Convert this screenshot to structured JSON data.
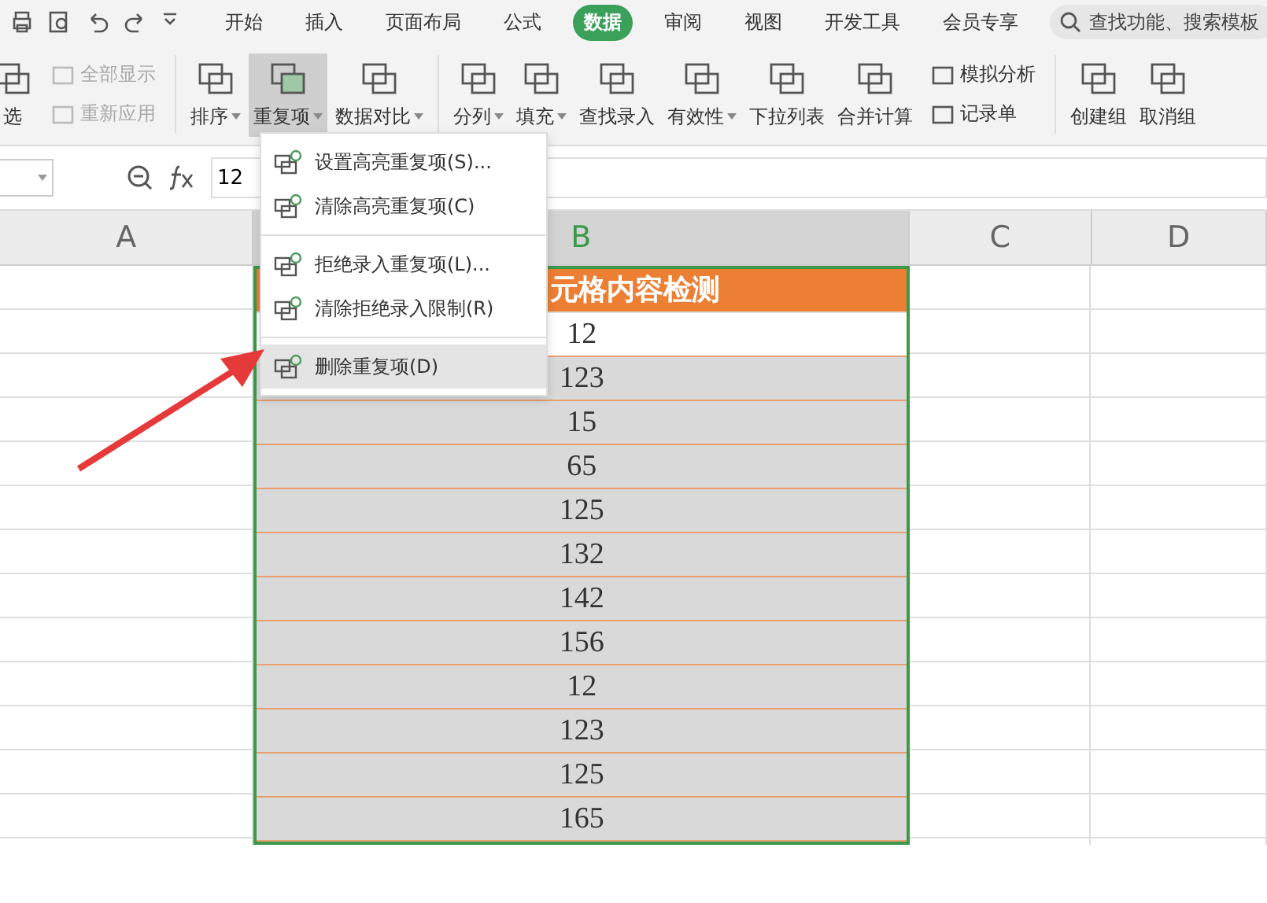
{
  "tabs": [
    {
      "label": "开始",
      "selected": false
    },
    {
      "label": "插入",
      "selected": false
    },
    {
      "label": "页面布局",
      "selected": false
    },
    {
      "label": "公式",
      "selected": false
    },
    {
      "label": "数据",
      "selected": true
    },
    {
      "label": "审阅",
      "selected": false
    },
    {
      "label": "视图",
      "selected": false
    },
    {
      "label": "开发工具",
      "selected": false
    },
    {
      "label": "会员专享",
      "selected": false
    }
  ],
  "search": {
    "placeholder": "查找功能、搜索模板"
  },
  "ribbon": [
    {
      "kind": "big",
      "label": "选",
      "dropdown": false,
      "pressed": false
    },
    {
      "kind": "stack",
      "items": [
        {
          "label": "全部显示",
          "disabled": true
        },
        {
          "label": "重新应用",
          "disabled": true
        }
      ]
    },
    {
      "kind": "sep"
    },
    {
      "kind": "big",
      "label": "排序",
      "dropdown": true,
      "pressed": false
    },
    {
      "kind": "big",
      "label": "重复项",
      "dropdown": true,
      "pressed": true
    },
    {
      "kind": "big",
      "label": "数据对比",
      "dropdown": true,
      "pressed": false
    },
    {
      "kind": "sep"
    },
    {
      "kind": "big",
      "label": "分列",
      "dropdown": true,
      "pressed": false
    },
    {
      "kind": "big",
      "label": "填充",
      "dropdown": true,
      "pressed": false
    },
    {
      "kind": "big",
      "label": "查找录入",
      "dropdown": false,
      "pressed": false
    },
    {
      "kind": "big",
      "label": "有效性",
      "dropdown": true,
      "pressed": false
    },
    {
      "kind": "big",
      "label": "下拉列表",
      "dropdown": false,
      "pressed": false
    },
    {
      "kind": "big",
      "label": "合并计算",
      "dropdown": false,
      "pressed": false
    },
    {
      "kind": "stack",
      "items": [
        {
          "label": "模拟分析",
          "disabled": false
        },
        {
          "label": "记录单",
          "disabled": false
        }
      ]
    },
    {
      "kind": "sep"
    },
    {
      "kind": "big",
      "label": "创建组",
      "dropdown": false,
      "pressed": false
    },
    {
      "kind": "big",
      "label": "取消组",
      "dropdown": false,
      "pressed": false
    }
  ],
  "formula_bar": {
    "value": "12"
  },
  "columns": [
    {
      "label": "A",
      "selected": false
    },
    {
      "label": "B",
      "selected": true
    },
    {
      "label": "C",
      "selected": false
    },
    {
      "label": "D",
      "selected": false
    }
  ],
  "table": {
    "header": "元格内容检测",
    "rows": [
      {
        "value": "12",
        "selected": false
      },
      {
        "value": "123",
        "selected": true
      },
      {
        "value": "15",
        "selected": true
      },
      {
        "value": "65",
        "selected": true
      },
      {
        "value": "125",
        "selected": true
      },
      {
        "value": "132",
        "selected": true
      },
      {
        "value": "142",
        "selected": true
      },
      {
        "value": "156",
        "selected": true
      },
      {
        "value": "12",
        "selected": true
      },
      {
        "value": "123",
        "selected": true
      },
      {
        "value": "125",
        "selected": true
      },
      {
        "value": "165",
        "selected": true
      }
    ]
  },
  "menu": [
    {
      "kind": "item",
      "label": "设置高亮重复项(S)...",
      "selected": false
    },
    {
      "kind": "item",
      "label": "清除高亮重复项(C)",
      "selected": false
    },
    {
      "kind": "sep"
    },
    {
      "kind": "item",
      "label": "拒绝录入重复项(L)...",
      "selected": false
    },
    {
      "kind": "item",
      "label": "清除拒绝录入限制(R)",
      "selected": false
    },
    {
      "kind": "sep"
    },
    {
      "kind": "item",
      "label": "删除重复项(D)",
      "selected": true
    }
  ]
}
